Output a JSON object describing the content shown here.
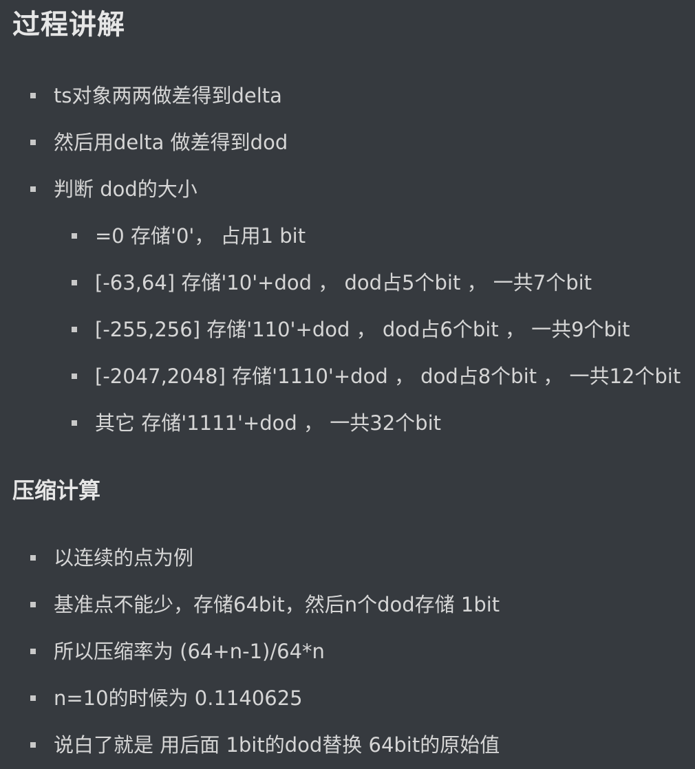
{
  "headings": {
    "process": "过程讲解",
    "compression": "压缩计算"
  },
  "process_list": [
    "ts对象两两做差得到delta",
    "然后用delta 做差得到dod",
    "判断 dod的大小"
  ],
  "dod_size_list": [
    "=0 存储'0'， 占用1 bit",
    "[-63,64] 存储'10'+dod ， dod占5个bit ， 一共7个bit",
    "[-255,256] 存储'110'+dod ， dod占6个bit ， 一共9个bit",
    "[-2047,2048] 存储'1110'+dod ， dod占8个bit ， 一共12个bit",
    "其它 存储'1111'+dod ， 一共32个bit"
  ],
  "compression_list": [
    "以连续的点为例",
    "基准点不能少，存储64bit，然后n个dod存储 1bit",
    "所以压缩率为 (64+n-1)/64*n",
    "n=10的时候为 0.1140625",
    "说白了就是 用后面 1bit的dod替换 64bit的原始值"
  ]
}
